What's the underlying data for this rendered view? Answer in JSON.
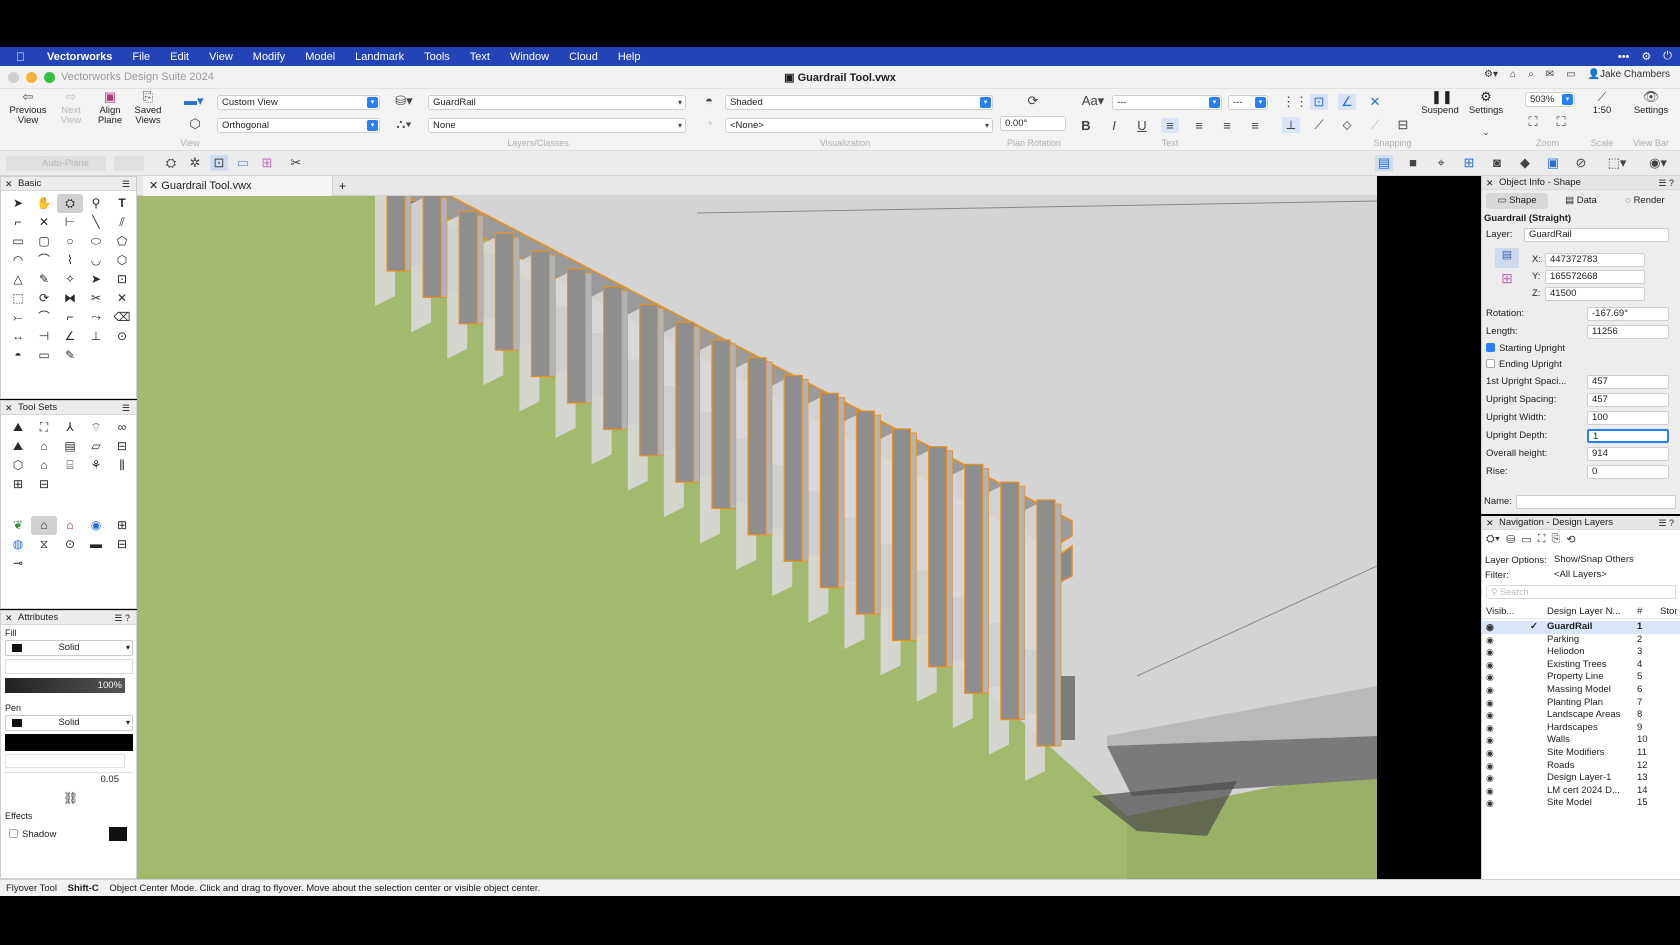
{
  "menubar": {
    "app": "Vectorworks",
    "items": [
      "File",
      "Edit",
      "View",
      "Modify",
      "Model",
      "Landmark",
      "Tools",
      "Text",
      "Window",
      "Cloud",
      "Help"
    ]
  },
  "titlebar": {
    "suite": "Vectorworks Design Suite 2024",
    "document": "Guardrail Tool.vwx",
    "user": "Jake Chambers"
  },
  "toolbar": {
    "previous_view": "Previous View",
    "next_view": "Next View",
    "align_plane": "Align Plane",
    "saved_views": "Saved Views",
    "view_group": "View",
    "view_select": "Custom View",
    "projection_select": "Orthogonal",
    "layer_select": "GuardRail",
    "class_select": "None",
    "layers_group": "Layers/Classes",
    "render_select": "Shaded",
    "style_select": "<None>",
    "visualization_group": "Visualization",
    "plan_rotation": "0.00°",
    "plan_rotation_group": "Plan Rotation",
    "text_group": "Text",
    "font_select": "---",
    "size_select": "---",
    "snapping_group": "Snapping",
    "suspend": "Suspend",
    "settings": "Settings",
    "zoom_value": "503%",
    "zoom_group": "Zoom",
    "scale_value": "1:50",
    "scale_group": "Scale",
    "settings2": "Settings",
    "viewbar_group": "View Bar",
    "auto_plane": "Auto-Plane"
  },
  "doc_tab": {
    "label": "Guardrail Tool.vwx",
    "add": "+"
  },
  "basic_palette": {
    "title": "Basic"
  },
  "toolsets_palette": {
    "title": "Tool Sets"
  },
  "attributes": {
    "title": "Attributes",
    "fill_label": "Fill",
    "fill_style": "Solid",
    "opacity": "100%",
    "pen_label": "Pen",
    "pen_style": "Solid",
    "line_weight": "0.05",
    "effects_label": "Effects",
    "shadow_label": "Shadow"
  },
  "object_info": {
    "title": "Object Info - Shape",
    "tabs": [
      "Shape",
      "Data",
      "Render"
    ],
    "object_type": "Guardrail (Straight)",
    "layer_label": "Layer:",
    "layer_value": "GuardRail",
    "x_label": "X:",
    "x_value": "447372783",
    "y_label": "Y:",
    "y_value": "165572668",
    "z_label": "Z:",
    "z_value": "41500",
    "fields": [
      {
        "label": "Rotation:",
        "value": "-167.69°"
      },
      {
        "label": "Length:",
        "value": "11256"
      }
    ],
    "starting_upright": "Starting Upright",
    "starting_checked": true,
    "ending_upright": "Ending Upright",
    "ending_checked": false,
    "fields2": [
      {
        "label": "1st Upright Spaci...",
        "value": "457"
      },
      {
        "label": "Upright Spacing:",
        "value": "457"
      },
      {
        "label": "Upright Width:",
        "value": "100"
      },
      {
        "label": "Upright Depth:",
        "value": "1"
      },
      {
        "label": "Overall height:",
        "value": "914"
      },
      {
        "label": "Rise:",
        "value": "0"
      }
    ],
    "name_label": "Name:"
  },
  "navigation": {
    "title": "Navigation - Design Layers",
    "layer_options_label": "Layer Options:",
    "layer_options_value": "Show/Snap Others",
    "filter_label": "Filter:",
    "filter_value": "<All Layers>",
    "search_placeholder": "Search",
    "col_visibility": "Visib...",
    "col_name": "Design Layer N...",
    "col_number": "#",
    "col_stor": "Stor",
    "layers": [
      {
        "name": "GuardRail",
        "number": "1",
        "active": true
      },
      {
        "name": "Parking",
        "number": "2"
      },
      {
        "name": "Heliodon",
        "number": "3"
      },
      {
        "name": "Existing Trees",
        "number": "4"
      },
      {
        "name": "Property Line",
        "number": "5"
      },
      {
        "name": "Massing Model",
        "number": "6"
      },
      {
        "name": "Planting Plan",
        "number": "7"
      },
      {
        "name": "Landscape Areas",
        "number": "8"
      },
      {
        "name": "Hardscapes",
        "number": "9"
      },
      {
        "name": "Walls",
        "number": "10"
      },
      {
        "name": "Site Modifiers",
        "number": "11"
      },
      {
        "name": "Roads",
        "number": "12"
      },
      {
        "name": "Design Layer-1",
        "number": "13"
      },
      {
        "name": "LM cert 2024 D...",
        "number": "14"
      },
      {
        "name": "Site Model",
        "number": "15"
      }
    ]
  },
  "status": {
    "tool": "Flyover Tool",
    "shortcut": "Shift-C",
    "message": "Object Center Mode. Click and drag to flyover.  Move about the selection center or visible object center."
  },
  "colors": {
    "menubar": "#2443b7",
    "accent": "#2a7ff5",
    "selection_orange": "#e8901e",
    "ground": "#a3ba6e",
    "slab": "#d4d4d4"
  }
}
